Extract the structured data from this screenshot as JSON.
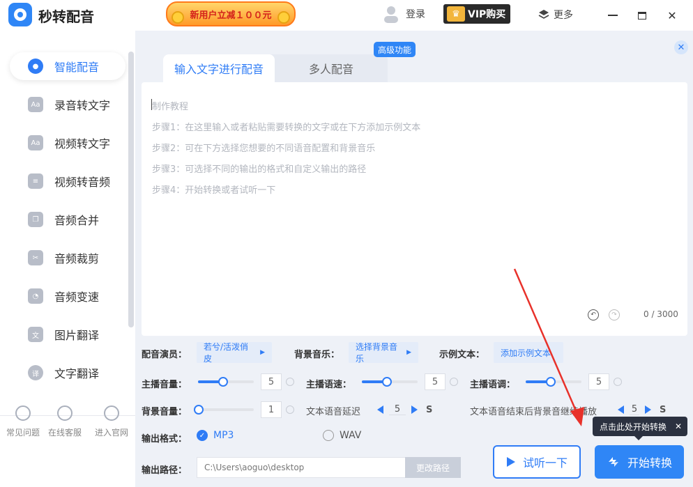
{
  "app": {
    "title": "秒转配音",
    "promo": "新用户立减１００元"
  },
  "header": {
    "login": "登录",
    "vip": "VIP购买",
    "more": "更多"
  },
  "sidebar": {
    "items": [
      {
        "label": "智能配音"
      },
      {
        "label": "录音转文字"
      },
      {
        "label": "视频转文字"
      },
      {
        "label": "视频转音频"
      },
      {
        "label": "音频合并"
      },
      {
        "label": "音频裁剪"
      },
      {
        "label": "音频变速"
      },
      {
        "label": "图片翻译"
      },
      {
        "label": "文字翻译"
      }
    ],
    "bottom": [
      {
        "label": "常见问题"
      },
      {
        "label": "在线客服"
      },
      {
        "label": "进入官网"
      }
    ]
  },
  "tabs": [
    {
      "label": "输入文字进行配音"
    },
    {
      "label": "多人配音"
    }
  ],
  "badge": "高级功能",
  "editor": {
    "lines": [
      "制作教程",
      "步骤1：在这里输入或者粘贴需要转换的文字或在下方添加示例文本",
      "步骤2：可在下方选择您想要的不同语音配置和背景音乐",
      "步骤3：可选择不同的输出的格式和自定义输出的路径",
      "步骤4：开始转换或者试听一下"
    ],
    "counter": "0 / 3000"
  },
  "controls": {
    "voice_label": "配音演员：",
    "voice_value": "若兮/活泼俏皮",
    "bgm_label": "背景音乐：",
    "bgm_value": "选择背景音乐",
    "sample_label": "示例文本：",
    "sample_value": "添加示例文本",
    "volume_label": "主播音量：",
    "volume_value": "5",
    "speed_label": "主播语速：",
    "speed_value": "5",
    "pitch_label": "主播语调：",
    "pitch_value": "5",
    "bg_volume_label": "背景音量：",
    "bg_volume_value": "1",
    "delay_label": "文本语音延迟",
    "delay_value": "5",
    "delay_unit": "S",
    "continue_label": "文本语音结束后背景音继续播放",
    "continue_value": "5",
    "continue_unit": "S",
    "format_label": "输出格式：",
    "format_mp3": "MP3",
    "format_wav": "WAV",
    "path_label": "输出路径：",
    "path_value": "C:\\Users\\aoguo\\desktop",
    "path_button": "更改路径"
  },
  "actions": {
    "listen": "试听一下",
    "start": "开始转换",
    "tip": "点击此处开始转换"
  },
  "sliders": {
    "volume": 0.44,
    "speed": 0.44,
    "pitch": 0.44,
    "bg_volume": 0.0
  }
}
